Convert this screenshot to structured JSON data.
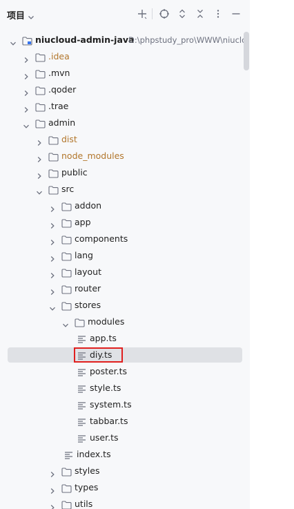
{
  "header": {
    "title": "项目",
    "actions": [
      "add-icon",
      "locate-icon",
      "expand-all-icon",
      "collapse-all-icon",
      "more-icon",
      "minimize-icon"
    ]
  },
  "tree": {
    "rows": [
      {
        "label": "niucloud-admin-java",
        "type": "module",
        "expanded": true,
        "bold": true,
        "path": "D:\\phpstudy_pro\\WWW\\niuclo"
      },
      {
        "label": ".idea",
        "type": "folder",
        "expanded": false,
        "excluded": true
      },
      {
        "label": ".mvn",
        "type": "folder",
        "expanded": false
      },
      {
        "label": ".qoder",
        "type": "folder",
        "expanded": false
      },
      {
        "label": ".trae",
        "type": "folder",
        "expanded": false
      },
      {
        "label": "admin",
        "type": "folder",
        "expanded": true
      },
      {
        "label": "dist",
        "type": "folder",
        "expanded": false,
        "excluded": true
      },
      {
        "label": "node_modules",
        "type": "folder",
        "expanded": false,
        "excluded": true
      },
      {
        "label": "public",
        "type": "folder",
        "expanded": false
      },
      {
        "label": "src",
        "type": "folder",
        "expanded": true
      },
      {
        "label": "addon",
        "type": "folder",
        "expanded": false
      },
      {
        "label": "app",
        "type": "folder",
        "expanded": false
      },
      {
        "label": "components",
        "type": "folder",
        "expanded": false
      },
      {
        "label": "lang",
        "type": "folder",
        "expanded": false
      },
      {
        "label": "layout",
        "type": "folder",
        "expanded": false
      },
      {
        "label": "router",
        "type": "folder",
        "expanded": false
      },
      {
        "label": "stores",
        "type": "folder",
        "expanded": true
      },
      {
        "label": "modules",
        "type": "folder",
        "expanded": true
      },
      {
        "label": "app.ts",
        "type": "file"
      },
      {
        "label": "diy.ts",
        "type": "file",
        "selected": true
      },
      {
        "label": "poster.ts",
        "type": "file"
      },
      {
        "label": "style.ts",
        "type": "file"
      },
      {
        "label": "system.ts",
        "type": "file"
      },
      {
        "label": "tabbar.ts",
        "type": "file"
      },
      {
        "label": "user.ts",
        "type": "file"
      },
      {
        "label": "index.ts",
        "type": "file"
      },
      {
        "label": "styles",
        "type": "folder",
        "expanded": false
      },
      {
        "label": "types",
        "type": "folder",
        "expanded": false
      },
      {
        "label": "utils",
        "type": "folder",
        "expanded": false
      }
    ]
  },
  "colors": {
    "panel_bg": "#f7f8fa",
    "selection": "#dfe1e5",
    "excluded_text": "#b2762b",
    "highlight_border": "#e01e1e"
  }
}
